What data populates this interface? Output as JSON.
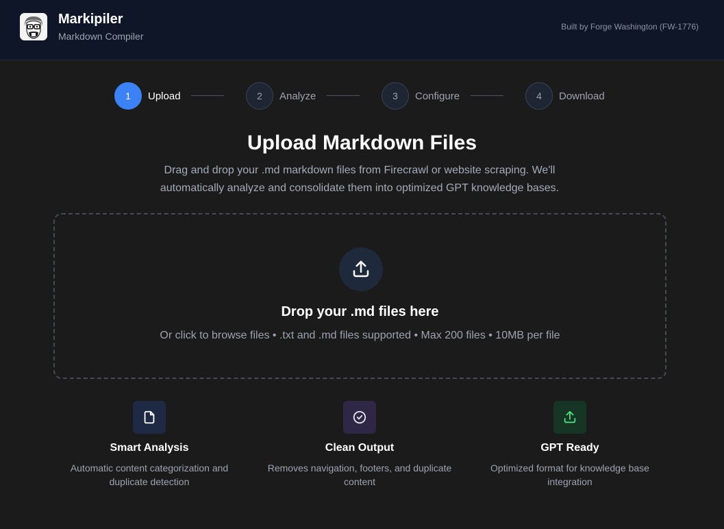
{
  "header": {
    "app_name": "Markipiler",
    "subtitle": "Markdown Compiler",
    "built_by": "Built by Forge Washington (FW-1776)"
  },
  "steps": [
    {
      "number": "1",
      "label": "Upload",
      "active": true
    },
    {
      "number": "2",
      "label": "Analyze",
      "active": false
    },
    {
      "number": "3",
      "label": "Configure",
      "active": false
    },
    {
      "number": "4",
      "label": "Download",
      "active": false
    }
  ],
  "main": {
    "title": "Upload Markdown Files",
    "description": "Drag and drop your .md markdown files from Firecrawl or website scraping. We'll automatically analyze and consolidate them into optimized GPT knowledge bases."
  },
  "dropzone": {
    "icon": "upload-icon",
    "title": "Drop your .md files here",
    "subtitle": "Or click to browse files • .txt and .md files supported • Max 200 files • 10MB per file"
  },
  "features": [
    {
      "icon": "file-icon",
      "title": "Smart Analysis",
      "description": "Automatic content categorization and duplicate detection",
      "bg": "#1e2a44",
      "color": "#ffffff"
    },
    {
      "icon": "check-circle-icon",
      "title": "Clean Output",
      "description": "Removes navigation, footers, and duplicate content",
      "bg": "#2e2745",
      "color": "#e5e7eb"
    },
    {
      "icon": "upload-icon",
      "title": "GPT Ready",
      "description": "Optimized format for knowledge base integration",
      "bg": "#163524",
      "color": "#4ade80"
    }
  ],
  "colors": {
    "accent": "#3b82f6",
    "header_bg": "#0e1628",
    "page_bg": "#1b1b1c"
  }
}
